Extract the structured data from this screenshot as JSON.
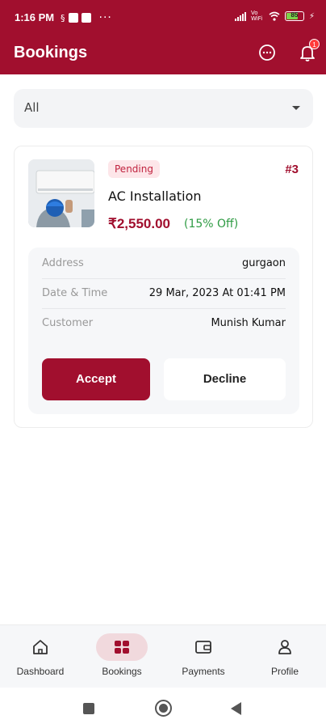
{
  "status_bar": {
    "time": "1:16 PM",
    "signal": "Vo WiFi",
    "battery": "85"
  },
  "app_bar": {
    "title": "Bookings",
    "notification_count": "1"
  },
  "filter": {
    "selected": "All"
  },
  "booking": {
    "status": "Pending",
    "id": "#3",
    "service": "AC Installation",
    "price": "₹2,550.00",
    "discount": "(15% Off)",
    "details": [
      {
        "label": "Address",
        "value": "gurgaon"
      },
      {
        "label": "Date & Time",
        "value": "29 Mar, 2023 At 01:41 PM"
      },
      {
        "label": "Customer",
        "value": "Munish Kumar"
      }
    ],
    "accept_label": "Accept",
    "decline_label": "Decline"
  },
  "bottom_nav": [
    {
      "label": "Dashboard",
      "icon": "home-icon"
    },
    {
      "label": "Bookings",
      "icon": "bookings-icon",
      "active": true
    },
    {
      "label": "Payments",
      "icon": "wallet-icon"
    },
    {
      "label": "Profile",
      "icon": "user-icon"
    }
  ],
  "colors": {
    "primary": "#a10f2e",
    "discount": "#2e9b43",
    "pending_bg": "#fde6e9"
  }
}
